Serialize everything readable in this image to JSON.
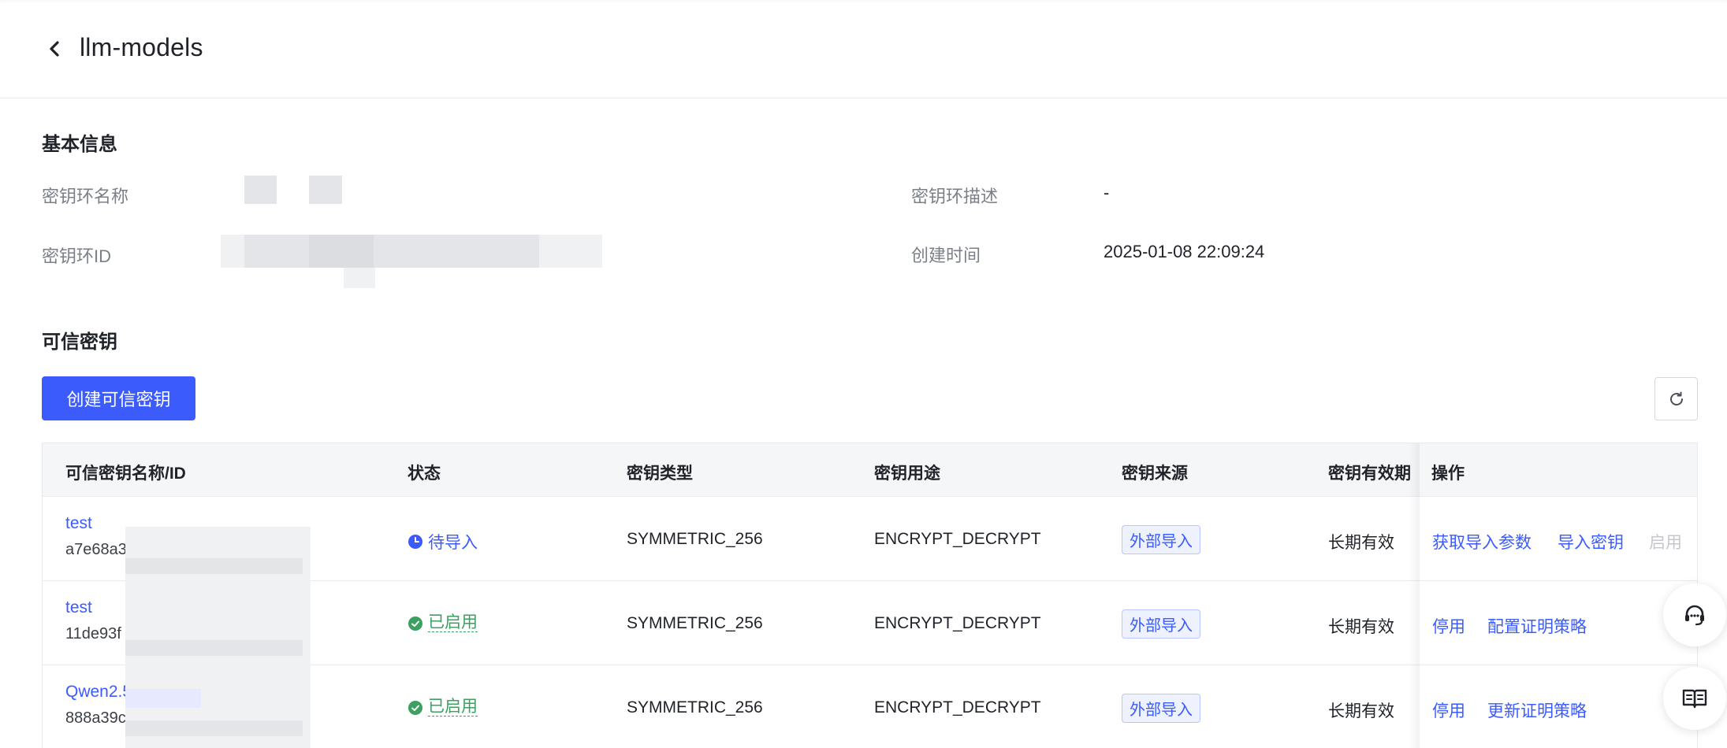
{
  "header": {
    "title": "llm-models"
  },
  "basic_info": {
    "title": "基本信息",
    "name_label": "密钥环名称",
    "desc_label": "密钥环描述",
    "desc_value": "-",
    "id_label": "密钥环ID",
    "created_label": "创建时间",
    "created_value": "2025-01-08 22:09:24"
  },
  "trusted_keys": {
    "title": "可信密钥",
    "create_button": "创建可信密钥",
    "columns": [
      "可信密钥名称/ID",
      "状态",
      "密钥类型",
      "密钥用途",
      "密钥来源",
      "密钥有效期",
      "操作"
    ],
    "rows": [
      {
        "name": "test",
        "id": "a7e68a3",
        "status": "待导入",
        "type": "SYMMETRIC_256",
        "usage": "ENCRYPT_DECRYPT",
        "source": "外部导入",
        "validity": "长期有效",
        "actions": [
          "获取导入参数",
          "导入密钥",
          "启用"
        ]
      },
      {
        "name": "test",
        "id": "11de93f",
        "status": "已启用",
        "type": "SYMMETRIC_256",
        "usage": "ENCRYPT_DECRYPT",
        "source": "外部导入",
        "validity": "长期有效",
        "actions": [
          "停用",
          "配置证明策略"
        ]
      },
      {
        "name": "Qwen2.5",
        "id": "888a39c",
        "status": "已启用",
        "type": "SYMMETRIC_256",
        "usage": "ENCRYPT_DECRYPT",
        "source": "外部导入",
        "validity": "长期有效",
        "actions": [
          "停用",
          "更新证明策略"
        ]
      }
    ]
  },
  "colors": {
    "primary": "#3b5bfd",
    "success": "#3ca061",
    "disabled": "#c4c7cc",
    "muted": "#7a7f88"
  },
  "icons": {
    "back": "chevron-left-icon",
    "refresh": "refresh-icon",
    "support": "headset-icon",
    "docs": "book-icon"
  }
}
